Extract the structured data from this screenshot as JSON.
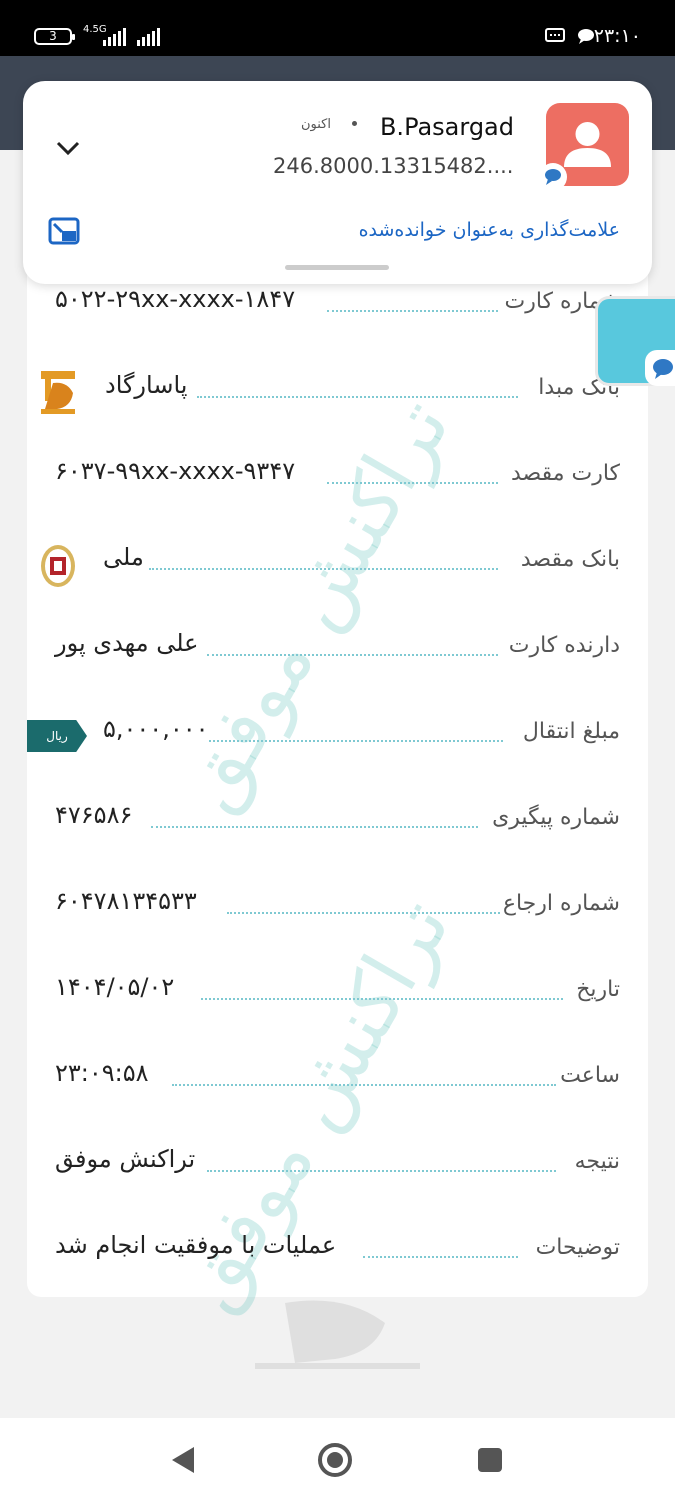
{
  "status_bar": {
    "battery": "3",
    "network": "4.5G",
    "time": "۲۳:۱۰"
  },
  "notification": {
    "sender": "B.Pasargad",
    "time": "اکنون",
    "body": "246.8000.13315482....",
    "action": "علامت‌گذاری به‌عنوان خوانده‌شده",
    "avatar_color": "#ed6e62"
  },
  "watermark": "تراکنش موفق",
  "rows": [
    {
      "label": "شماره کارت",
      "value": "۵۰۲۲-۲۹xx-xxxx-۱۸۴۷"
    },
    {
      "label": "بانک مبدا",
      "value": "پاسارگاد"
    },
    {
      "label": "کارت مقصد",
      "value": "۶۰۳۷-۹۹xx-xxxx-۹۳۴۷"
    },
    {
      "label": "بانک مقصد",
      "value": "ملی"
    },
    {
      "label": "دارنده کارت",
      "value": "علی مهدی پور"
    },
    {
      "label": "مبلغ انتقال",
      "value": "۵,۰۰۰,۰۰۰"
    },
    {
      "label": "شماره پیگیری",
      "value": "۴۷۶۵۸۶"
    },
    {
      "label": "شماره ارجاع",
      "value": "۶۰۴۷۸۱۳۴۵۳۳"
    },
    {
      "label": "تاریخ",
      "value": "۱۴۰۴/۰۵/۰۲"
    },
    {
      "label": "ساعت",
      "value": "۲۳:۰۹:۵۸"
    },
    {
      "label": "نتیجه",
      "value": "تراکنش موفق"
    },
    {
      "label": "توضیحات",
      "value": "عملیات با موفقیت انجام شد"
    }
  ],
  "currency_badge": "ریال",
  "colors": {
    "accent_teal": "#1b6b6c",
    "dotted_line": "#7fc9d2",
    "link_blue": "#1c66c4"
  }
}
